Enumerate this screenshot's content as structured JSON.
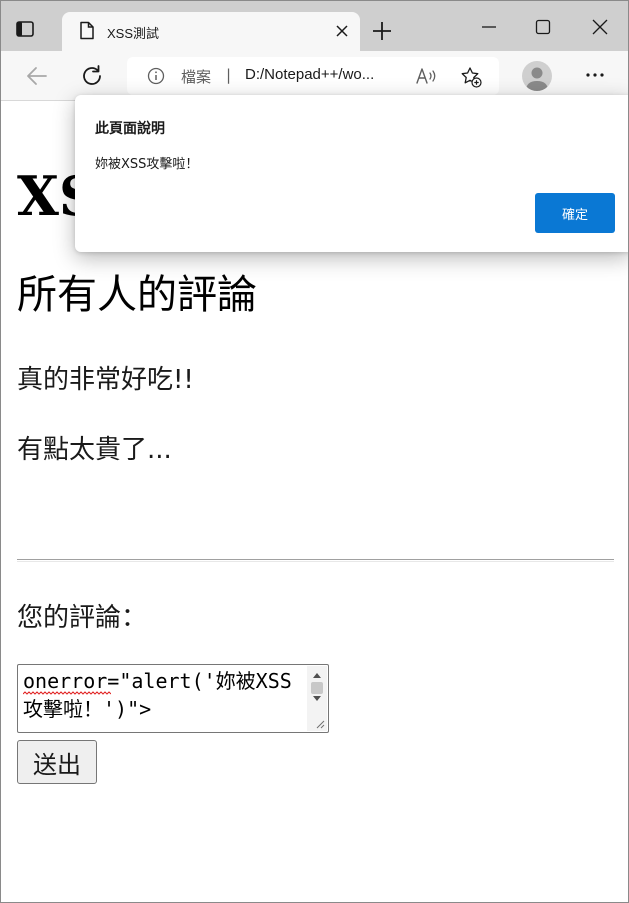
{
  "browser": {
    "tab": {
      "title": "XSS測試"
    },
    "addressbar": {
      "scheme_label": "檔案",
      "separator": "|",
      "url": "D:/Notepad++/wo..."
    },
    "icons": {
      "tab_actions": "tab-actions-icon",
      "favicon": "page-icon",
      "tab_close": "close-icon",
      "new_tab": "plus-icon",
      "minimize": "minimize-icon",
      "maximize": "maximize-icon",
      "close_window": "close-icon",
      "back": "back-arrow-icon",
      "refresh": "refresh-icon",
      "info": "info-icon",
      "read_aloud": "read-aloud-icon",
      "favorites": "add-favorite-icon",
      "profile": "profile-icon",
      "more": "more-icon"
    }
  },
  "page": {
    "heading": "XSS測試",
    "comments_heading": "所有人的評論",
    "comments": [
      "真的非常好吃!!",
      "有點太貴了..."
    ],
    "form": {
      "label": "您的評論：",
      "textarea_value": "onerror=\"alert('妳被XSS攻擊啦！')\">",
      "submit_label": "送出"
    }
  },
  "dialog": {
    "title": "此頁面說明",
    "message": "妳被XSS攻擊啦！",
    "ok_label": "確定"
  },
  "colors": {
    "tabstrip": "#cfcfcf",
    "toolbar": "#f7f7f7",
    "accent": "#0a78d4"
  }
}
